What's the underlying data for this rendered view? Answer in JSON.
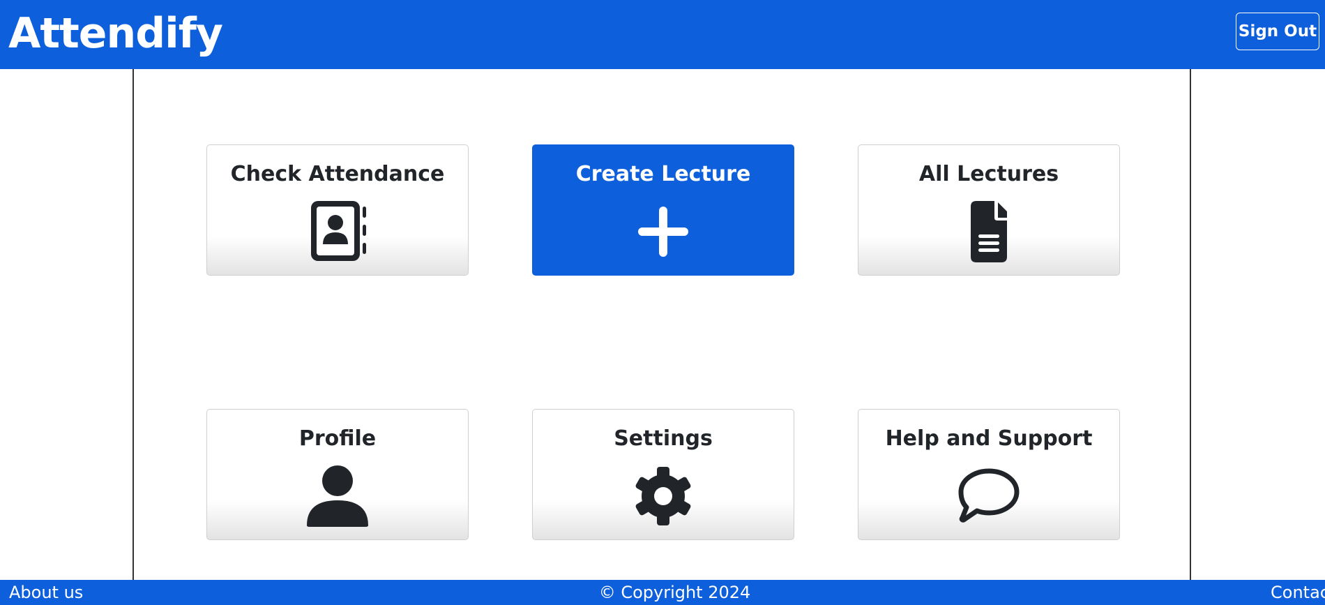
{
  "header": {
    "brand": "Attendify",
    "sign_out_label": "Sign Out"
  },
  "cards": [
    {
      "label": "Check Attendance",
      "icon": "contact-book-icon"
    },
    {
      "label": "Create Lecture",
      "icon": "plus-icon"
    },
    {
      "label": "All Lectures",
      "icon": "document-icon"
    },
    {
      "label": "Profile",
      "icon": "person-icon"
    },
    {
      "label": "Settings",
      "icon": "gear-icon"
    },
    {
      "label": "Help and Support",
      "icon": "chat-bubble-icon"
    }
  ],
  "footer": {
    "about_label": "About us",
    "copyright": "© Copyright 2024",
    "contact_label": "Contac"
  },
  "colors": {
    "brand_blue": "#0d5fdb",
    "icon_dark": "#212529",
    "white": "#ffffff"
  }
}
